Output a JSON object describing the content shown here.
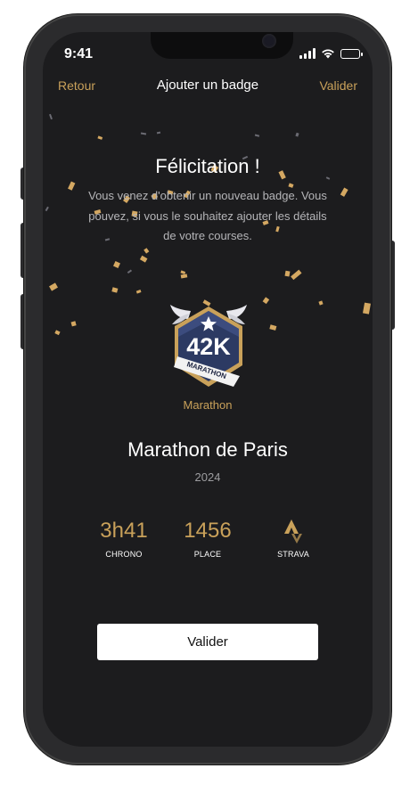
{
  "status_bar": {
    "time": "9:41",
    "icons": [
      "signal-icon",
      "wifi-icon",
      "battery-icon"
    ]
  },
  "nav": {
    "back_label": "Retour",
    "title": "Ajouter un badge",
    "validate_label": "Valider"
  },
  "content": {
    "heading": "Félicitation !",
    "subtext": "Vous venez d'obtenir un nouveau badge. Vous pouvez, si vous le souhaitez ajouter les détails de votre courses."
  },
  "badge": {
    "distance": "42K",
    "ribbon": "MARATHON",
    "label": "Marathon",
    "icon": "marathon-badge-icon"
  },
  "race": {
    "title": "Marathon de Paris",
    "year": "2024"
  },
  "stats": [
    {
      "value": "3h41",
      "label": "CHRONO"
    },
    {
      "value": "1456",
      "label": "PLACE"
    },
    {
      "value": "",
      "label": "STRAVA",
      "icon": "strava-icon"
    }
  ],
  "cta": {
    "label": "Valider"
  },
  "colors": {
    "accent": "#c9a15a",
    "background": "#1c1c1e",
    "badge_navy": "#2c3a63",
    "text": "#ffffff"
  }
}
